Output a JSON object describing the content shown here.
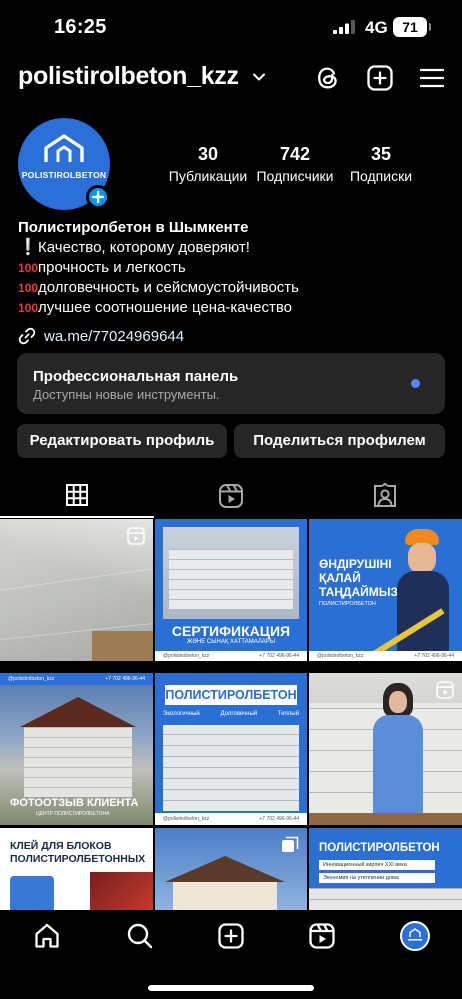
{
  "status": {
    "time": "16:25",
    "network": "4G",
    "battery": "71"
  },
  "header": {
    "username": "polistirolbeton_kzz"
  },
  "profile": {
    "avatar_brand": "POLISTIROLBETON",
    "stats": [
      {
        "value": "30",
        "label": "Публикации"
      },
      {
        "value": "742",
        "label": "Подписчики"
      },
      {
        "value": "35",
        "label": "Подписки"
      }
    ],
    "bio_name": "Полистиролбетон в Шымкенте",
    "bio_lines": [
      {
        "emoji": "❕",
        "text": "Качество, которому доверяют!"
      },
      {
        "emoji": "100",
        "text": "прочность и легкость"
      },
      {
        "emoji": "100",
        "text": "долговечность и сейсмоустойчивость"
      },
      {
        "emoji": "100",
        "text": "лучшее соотношение цена-качество"
      }
    ],
    "link": "wa.me/77024969644"
  },
  "panel": {
    "title": "Профессиональная панель",
    "subtitle": "Доступны новые инструменты."
  },
  "buttons": {
    "edit": "Редактировать профиль",
    "share": "Поделиться профилем"
  },
  "posts": {
    "cert_title": "СЕРТИФИКАЦИЯ",
    "cert_sub": "ЖӘНЕ СЫНАҚ ХАТТАМАЛАРЫ",
    "who_title_1": "ӨНДІРУШІНІ",
    "who_title_2": "ҚАЛАЙ",
    "who_title_3": "ТАҢДАЙМЫЗ?",
    "who_badge": "ПОЛИСТИРОЛБЕТОН",
    "review_title": "ФОТООТЗЫВ КЛИЕНТА",
    "review_sub": "ЦЕНТР ПОЛИСТИРОЛБЕТОНА",
    "pb_title": "ПОЛИСТИРОЛБЕТОН",
    "pb_tags": [
      "Экологичный",
      "Долговечный",
      "Теплый"
    ],
    "glue_title_1": "КЛЕЙ ДЛЯ БЛОКОВ",
    "glue_title_2": "ПОЛИСТИРОЛБЕТОННЫХ",
    "last_title": "ПОЛИСТИРОЛБЕТОН",
    "last_tag_1": "Инновационный кирпич XXI века",
    "last_tag_2": "Экономия на утеплении дома",
    "handle": "@polistirolbeton_kzz",
    "phone": "+7 702 496-96-44"
  },
  "colors": {
    "accent": "#0095f6",
    "brand_blue": "#2b6fd8",
    "panel": "#262626"
  }
}
